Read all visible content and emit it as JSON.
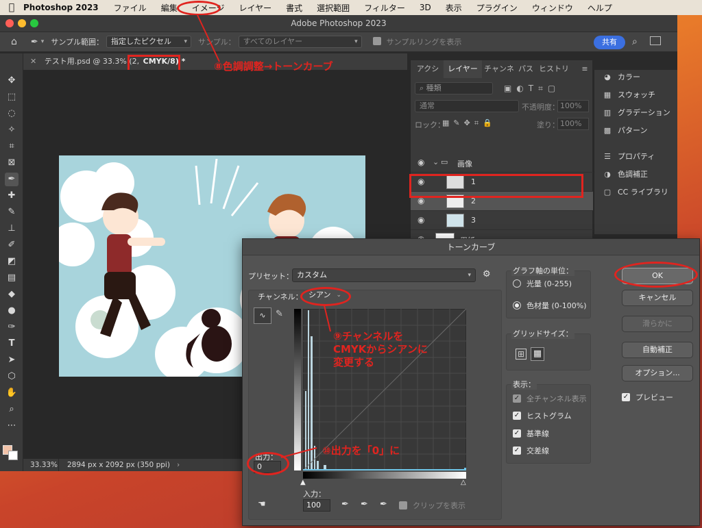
{
  "menubar": {
    "app": "Photoshop 2023",
    "items": [
      "ファイル",
      "編集",
      "イメージ",
      "レイヤー",
      "書式",
      "選択範囲",
      "フィルター",
      "3D",
      "表示",
      "プラグイン",
      "ウィンドウ",
      "ヘルプ"
    ]
  },
  "window": {
    "title": "Adobe Photoshop 2023"
  },
  "options": {
    "sample_label": "サンプル範囲：",
    "sample_value": "指定したピクセル",
    "sample2_label": "サンプル：",
    "sample2_value": "すべてのレイヤー",
    "ring_label": "サンプルリングを表示",
    "share": "共有"
  },
  "document": {
    "tab_name": "テスト用.psd @ 33.3% (2,",
    "tab_mode": "CMYK/8) *",
    "zoom": "33.33%",
    "size": "2894 px x 2092 px (350 ppi)"
  },
  "layers_panel": {
    "tabs": [
      "アクショ",
      "レイヤー",
      "チャンネ",
      "パス",
      "ヒストリ"
    ],
    "search_placeholder": "種類",
    "blend_mode": "通常",
    "opacity_label": "不透明度：",
    "opacity_value": "100%",
    "lock_label": "ロック：",
    "fill_label": "塗り：",
    "fill_value": "100%",
    "layers": [
      {
        "name": "画像"
      },
      {
        "name": "1"
      },
      {
        "name": "2"
      },
      {
        "name": "3"
      },
      {
        "name": "用紙"
      }
    ]
  },
  "side_panel": {
    "items": [
      "カラー",
      "スウォッチ",
      "グラデーション",
      "パターン",
      "プロパティ",
      "色調補正",
      "CC ライブラリ"
    ]
  },
  "curves": {
    "title": "トーンカーブ",
    "preset_label": "プリセット：",
    "preset_value": "カスタム",
    "channel_label": "チャンネル：",
    "channel_value": "シアン",
    "output_label": "出力：",
    "output_value": "0",
    "input_label": "入力：",
    "input_value": "100",
    "clip_label": "クリップを表示",
    "axis_group_title": "グラフ軸の単位：",
    "axis_light": "光量 (0-255)",
    "axis_pigment": "色材量 (0-100%)",
    "grid_title": "グリッドサイズ：",
    "display_title": "表示：",
    "show_all": "全チャンネル表示",
    "show_histogram": "ヒストグラム",
    "show_baseline": "基準線",
    "show_intersect": "交差線",
    "buttons": {
      "ok": "OK",
      "cancel": "キャンセル",
      "smooth": "滑らかに",
      "auto": "自動補正",
      "options": "オプション...",
      "preview": "プレビュー"
    }
  },
  "annotations": {
    "step8": "⑧色調調整→トーンカーブ",
    "step9": "⑨チャンネルを\nCMYKからシアンに\n変更する",
    "step10": "⑩出力を「0」に"
  },
  "colors": {
    "accent": "#e0241f",
    "share": "#3b6fe0",
    "artwork_sky": "#a8d4dc"
  }
}
